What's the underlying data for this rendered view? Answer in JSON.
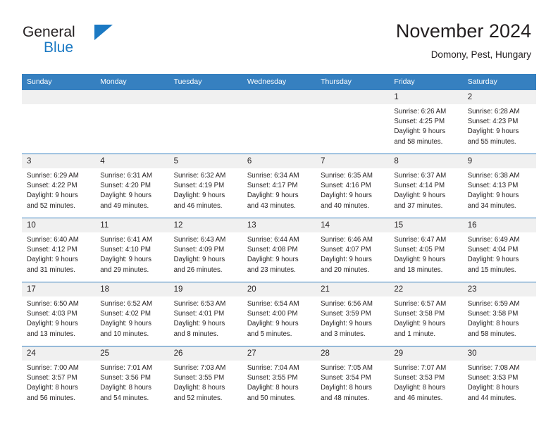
{
  "brand": {
    "name_part1": "General",
    "name_part2": "Blue"
  },
  "header": {
    "title": "November 2024",
    "subtitle": "Domony, Pest, Hungary"
  },
  "colors": {
    "header_blue": "#3680c0",
    "brand_blue": "#1b79c3",
    "day_band": "#f0f0f0",
    "text": "#231f20"
  },
  "weekdays": [
    "Sunday",
    "Monday",
    "Tuesday",
    "Wednesday",
    "Thursday",
    "Friday",
    "Saturday"
  ],
  "weeks": [
    [
      {
        "day": "",
        "sunrise": "",
        "sunset": "",
        "daylight1": "",
        "daylight2": ""
      },
      {
        "day": "",
        "sunrise": "",
        "sunset": "",
        "daylight1": "",
        "daylight2": ""
      },
      {
        "day": "",
        "sunrise": "",
        "sunset": "",
        "daylight1": "",
        "daylight2": ""
      },
      {
        "day": "",
        "sunrise": "",
        "sunset": "",
        "daylight1": "",
        "daylight2": ""
      },
      {
        "day": "",
        "sunrise": "",
        "sunset": "",
        "daylight1": "",
        "daylight2": ""
      },
      {
        "day": "1",
        "sunrise": "Sunrise: 6:26 AM",
        "sunset": "Sunset: 4:25 PM",
        "daylight1": "Daylight: 9 hours",
        "daylight2": "and 58 minutes."
      },
      {
        "day": "2",
        "sunrise": "Sunrise: 6:28 AM",
        "sunset": "Sunset: 4:23 PM",
        "daylight1": "Daylight: 9 hours",
        "daylight2": "and 55 minutes."
      }
    ],
    [
      {
        "day": "3",
        "sunrise": "Sunrise: 6:29 AM",
        "sunset": "Sunset: 4:22 PM",
        "daylight1": "Daylight: 9 hours",
        "daylight2": "and 52 minutes."
      },
      {
        "day": "4",
        "sunrise": "Sunrise: 6:31 AM",
        "sunset": "Sunset: 4:20 PM",
        "daylight1": "Daylight: 9 hours",
        "daylight2": "and 49 minutes."
      },
      {
        "day": "5",
        "sunrise": "Sunrise: 6:32 AM",
        "sunset": "Sunset: 4:19 PM",
        "daylight1": "Daylight: 9 hours",
        "daylight2": "and 46 minutes."
      },
      {
        "day": "6",
        "sunrise": "Sunrise: 6:34 AM",
        "sunset": "Sunset: 4:17 PM",
        "daylight1": "Daylight: 9 hours",
        "daylight2": "and 43 minutes."
      },
      {
        "day": "7",
        "sunrise": "Sunrise: 6:35 AM",
        "sunset": "Sunset: 4:16 PM",
        "daylight1": "Daylight: 9 hours",
        "daylight2": "and 40 minutes."
      },
      {
        "day": "8",
        "sunrise": "Sunrise: 6:37 AM",
        "sunset": "Sunset: 4:14 PM",
        "daylight1": "Daylight: 9 hours",
        "daylight2": "and 37 minutes."
      },
      {
        "day": "9",
        "sunrise": "Sunrise: 6:38 AM",
        "sunset": "Sunset: 4:13 PM",
        "daylight1": "Daylight: 9 hours",
        "daylight2": "and 34 minutes."
      }
    ],
    [
      {
        "day": "10",
        "sunrise": "Sunrise: 6:40 AM",
        "sunset": "Sunset: 4:12 PM",
        "daylight1": "Daylight: 9 hours",
        "daylight2": "and 31 minutes."
      },
      {
        "day": "11",
        "sunrise": "Sunrise: 6:41 AM",
        "sunset": "Sunset: 4:10 PM",
        "daylight1": "Daylight: 9 hours",
        "daylight2": "and 29 minutes."
      },
      {
        "day": "12",
        "sunrise": "Sunrise: 6:43 AM",
        "sunset": "Sunset: 4:09 PM",
        "daylight1": "Daylight: 9 hours",
        "daylight2": "and 26 minutes."
      },
      {
        "day": "13",
        "sunrise": "Sunrise: 6:44 AM",
        "sunset": "Sunset: 4:08 PM",
        "daylight1": "Daylight: 9 hours",
        "daylight2": "and 23 minutes."
      },
      {
        "day": "14",
        "sunrise": "Sunrise: 6:46 AM",
        "sunset": "Sunset: 4:07 PM",
        "daylight1": "Daylight: 9 hours",
        "daylight2": "and 20 minutes."
      },
      {
        "day": "15",
        "sunrise": "Sunrise: 6:47 AM",
        "sunset": "Sunset: 4:05 PM",
        "daylight1": "Daylight: 9 hours",
        "daylight2": "and 18 minutes."
      },
      {
        "day": "16",
        "sunrise": "Sunrise: 6:49 AM",
        "sunset": "Sunset: 4:04 PM",
        "daylight1": "Daylight: 9 hours",
        "daylight2": "and 15 minutes."
      }
    ],
    [
      {
        "day": "17",
        "sunrise": "Sunrise: 6:50 AM",
        "sunset": "Sunset: 4:03 PM",
        "daylight1": "Daylight: 9 hours",
        "daylight2": "and 13 minutes."
      },
      {
        "day": "18",
        "sunrise": "Sunrise: 6:52 AM",
        "sunset": "Sunset: 4:02 PM",
        "daylight1": "Daylight: 9 hours",
        "daylight2": "and 10 minutes."
      },
      {
        "day": "19",
        "sunrise": "Sunrise: 6:53 AM",
        "sunset": "Sunset: 4:01 PM",
        "daylight1": "Daylight: 9 hours",
        "daylight2": "and 8 minutes."
      },
      {
        "day": "20",
        "sunrise": "Sunrise: 6:54 AM",
        "sunset": "Sunset: 4:00 PM",
        "daylight1": "Daylight: 9 hours",
        "daylight2": "and 5 minutes."
      },
      {
        "day": "21",
        "sunrise": "Sunrise: 6:56 AM",
        "sunset": "Sunset: 3:59 PM",
        "daylight1": "Daylight: 9 hours",
        "daylight2": "and 3 minutes."
      },
      {
        "day": "22",
        "sunrise": "Sunrise: 6:57 AM",
        "sunset": "Sunset: 3:58 PM",
        "daylight1": "Daylight: 9 hours",
        "daylight2": "and 1 minute."
      },
      {
        "day": "23",
        "sunrise": "Sunrise: 6:59 AM",
        "sunset": "Sunset: 3:58 PM",
        "daylight1": "Daylight: 8 hours",
        "daylight2": "and 58 minutes."
      }
    ],
    [
      {
        "day": "24",
        "sunrise": "Sunrise: 7:00 AM",
        "sunset": "Sunset: 3:57 PM",
        "daylight1": "Daylight: 8 hours",
        "daylight2": "and 56 minutes."
      },
      {
        "day": "25",
        "sunrise": "Sunrise: 7:01 AM",
        "sunset": "Sunset: 3:56 PM",
        "daylight1": "Daylight: 8 hours",
        "daylight2": "and 54 minutes."
      },
      {
        "day": "26",
        "sunrise": "Sunrise: 7:03 AM",
        "sunset": "Sunset: 3:55 PM",
        "daylight1": "Daylight: 8 hours",
        "daylight2": "and 52 minutes."
      },
      {
        "day": "27",
        "sunrise": "Sunrise: 7:04 AM",
        "sunset": "Sunset: 3:55 PM",
        "daylight1": "Daylight: 8 hours",
        "daylight2": "and 50 minutes."
      },
      {
        "day": "28",
        "sunrise": "Sunrise: 7:05 AM",
        "sunset": "Sunset: 3:54 PM",
        "daylight1": "Daylight: 8 hours",
        "daylight2": "and 48 minutes."
      },
      {
        "day": "29",
        "sunrise": "Sunrise: 7:07 AM",
        "sunset": "Sunset: 3:53 PM",
        "daylight1": "Daylight: 8 hours",
        "daylight2": "and 46 minutes."
      },
      {
        "day": "30",
        "sunrise": "Sunrise: 7:08 AM",
        "sunset": "Sunset: 3:53 PM",
        "daylight1": "Daylight: 8 hours",
        "daylight2": "and 44 minutes."
      }
    ]
  ]
}
